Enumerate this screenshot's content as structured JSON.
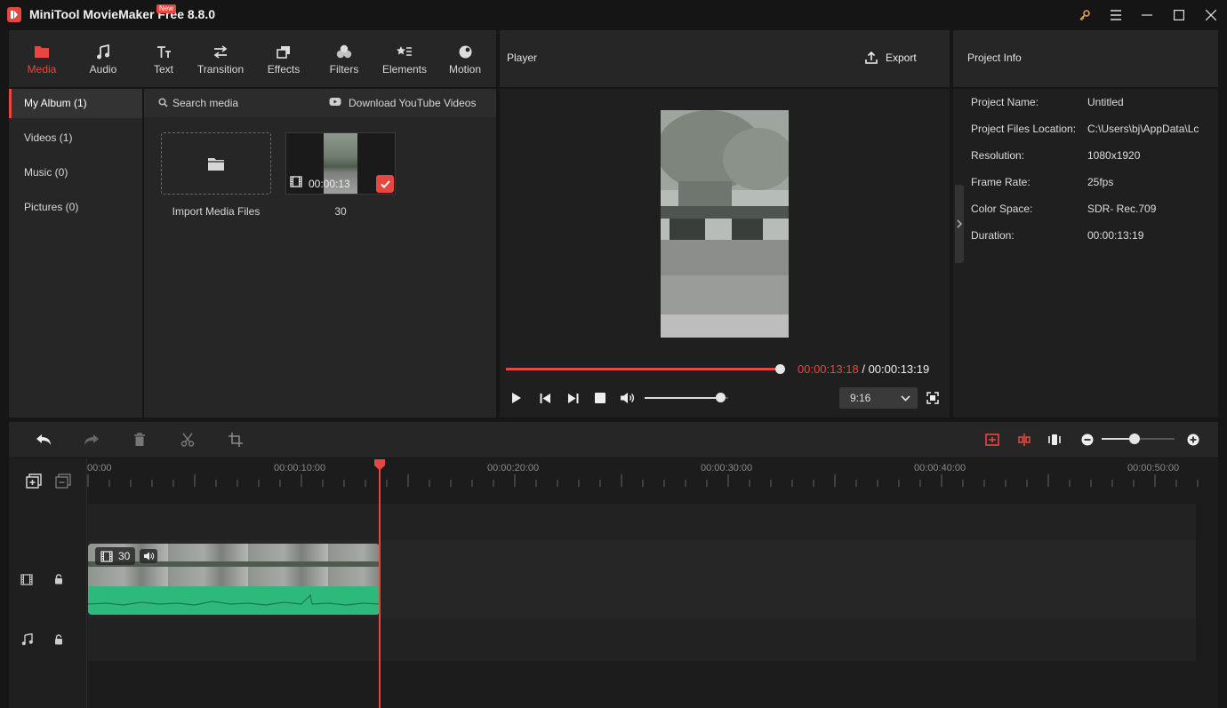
{
  "app": {
    "title": "MiniTool MovieMaker Free 8.8.0"
  },
  "toolbar": {
    "items": [
      {
        "label": "Media",
        "icon": "folder-icon",
        "active": true
      },
      {
        "label": "Audio",
        "icon": "music-note-icon"
      },
      {
        "label": "Text",
        "icon": "text-icon",
        "badge": "New"
      },
      {
        "label": "Transition",
        "icon": "swap-arrows-icon"
      },
      {
        "label": "Effects",
        "icon": "layers-icon"
      },
      {
        "label": "Filters",
        "icon": "circles-icon"
      },
      {
        "label": "Elements",
        "icon": "shapes-icon"
      },
      {
        "label": "Motion",
        "icon": "motion-ball-icon"
      }
    ]
  },
  "sidebar": {
    "items": [
      {
        "label": "My Album (1)",
        "active": true
      },
      {
        "label": "Videos (1)"
      },
      {
        "label": "Music (0)"
      },
      {
        "label": "Pictures (0)"
      }
    ]
  },
  "media": {
    "search_placeholder": "Search media",
    "download_label": "Download YouTube Videos",
    "import_label": "Import Media Files",
    "clip": {
      "name": "30",
      "duration": "00:00:13"
    }
  },
  "player": {
    "title": "Player",
    "export_label": "Export",
    "current_time": "00:00:13:18",
    "separator": "/",
    "total_time": "00:00:13:19",
    "progress": 1.0,
    "volume": 0.9,
    "aspect_ratio": "9:16"
  },
  "project_info": {
    "title": "Project Info",
    "rows": [
      {
        "label": "Project Name:",
        "value": "Untitled"
      },
      {
        "label": "Project Files Location:",
        "value": "C:\\Users\\bj\\AppData\\Lc"
      },
      {
        "label": "Resolution:",
        "value": "1080x1920"
      },
      {
        "label": "Frame Rate:",
        "value": "25fps"
      },
      {
        "label": "Color Space:",
        "value": "SDR- Rec.709"
      },
      {
        "label": "Duration:",
        "value": "00:00:13:19"
      }
    ]
  },
  "timeline": {
    "ruler": [
      "00:00",
      "00:00:10:00",
      "00:00:20:00",
      "00:00:30:00",
      "00:00:40:00",
      "00:00:50:00"
    ],
    "clip_label": "30",
    "zoom": 0.45
  },
  "colors": {
    "accent": "#e8473f",
    "audio_wave": "#2db87c"
  }
}
